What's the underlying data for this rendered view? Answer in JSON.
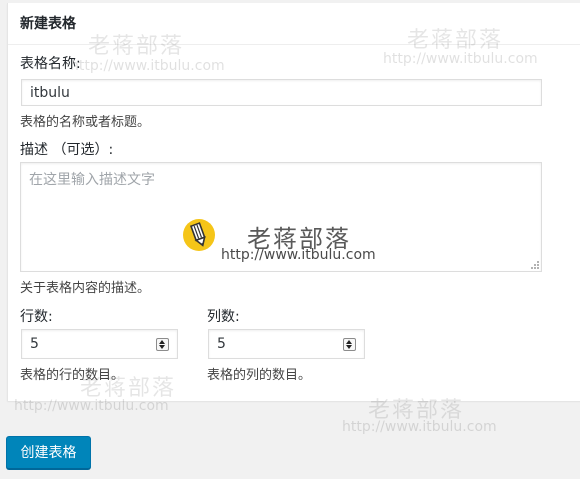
{
  "panel": {
    "title": "新建表格",
    "name_label": "表格名称:",
    "name_value": "itbulu",
    "name_help": "表格的名称或者标题。",
    "desc_label": "描述 （可选）:",
    "desc_placeholder": "在这里输入描述文字",
    "desc_help": "关于表格内容的描述。",
    "rows_label": "行数:",
    "rows_value": "5",
    "rows_help": "表格的行的数目。",
    "cols_label": "列数:",
    "cols_value": "5",
    "cols_help": "表格的列的数目。"
  },
  "actions": {
    "create_button": "创建表格"
  },
  "watermark": {
    "brand": "老蒋部落",
    "url": "http://www.itbulu.com"
  },
  "colors": {
    "primary_button": "#0085ba",
    "logo_yellow": "#f5c518"
  }
}
